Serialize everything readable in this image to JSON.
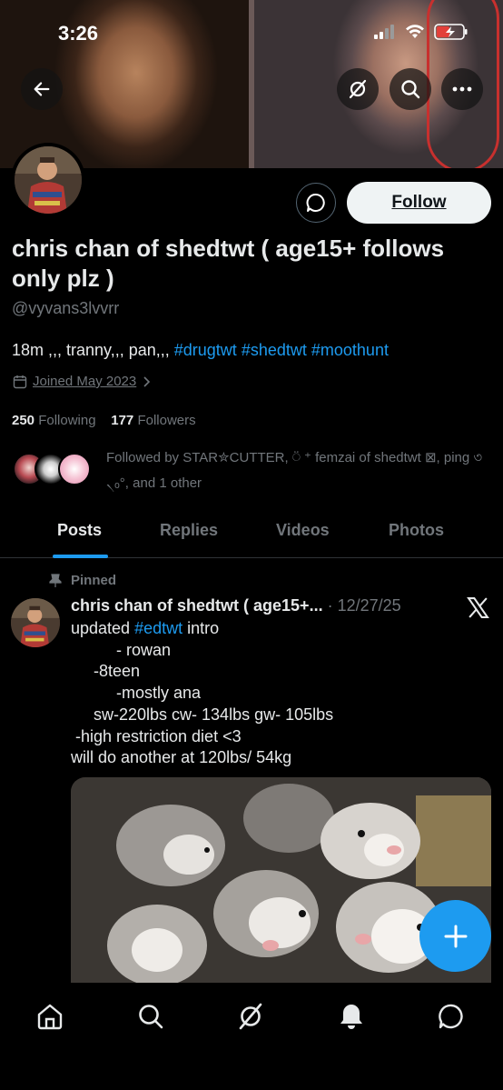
{
  "status_bar": {
    "time": "3:26"
  },
  "profile": {
    "display_name": "chris chan of shedtwt ( age15+ follows only plz )",
    "handle": "@vyvans3lvvrr",
    "bio_text": "18m ,,, tranny,,, pan,,, ",
    "bio_hashtags": [
      "#drugtwt",
      "#shedtwt",
      "#moothunt"
    ],
    "joined": "Joined May 2023",
    "following_count": "250",
    "following_label": "Following",
    "followers_count": "177",
    "followers_label": "Followers",
    "followed_by": "Followed by STAR✮CUTTER, ⍥ ⁺ femzai of shedtwt ⊠, ping ৩ ৲ₒ°, and 1 other",
    "follow_label": "Follow"
  },
  "tabs": [
    {
      "label": "Posts",
      "active": true
    },
    {
      "label": "Replies",
      "active": false
    },
    {
      "label": "Videos",
      "active": false
    },
    {
      "label": "Photos",
      "active": false
    }
  ],
  "pinned_tweet": {
    "pinned_label": "Pinned",
    "author": "chris chan of shedtwt ( age15+...",
    "date": "· 12/27/25",
    "text_prefix": "updated ",
    "text_hashtag": "#edtwt",
    "text_suffix": " intro",
    "body_lines": "          - rowan\n     -8teen\n          -mostly ana\n     sw-220lbs cw- 134lbs gw- 105lbs\n -high restriction diet <3\nwill do another at 120lbs/ 54kg"
  },
  "icons": {
    "back": "back-arrow-icon",
    "grok": "grok-icon",
    "search": "search-icon",
    "more": "more-icon",
    "message": "message-icon",
    "calendar": "calendar-icon",
    "pin": "pin-icon",
    "x_logo": "x-logo-icon",
    "compose": "plus-icon",
    "nav": [
      "home-icon",
      "search-icon",
      "grok-icon",
      "bell-icon",
      "chat-icon"
    ]
  },
  "colors": {
    "accent": "#1d9bf0",
    "background": "#000000",
    "muted": "#71767b",
    "text": "#e7e9ea"
  }
}
